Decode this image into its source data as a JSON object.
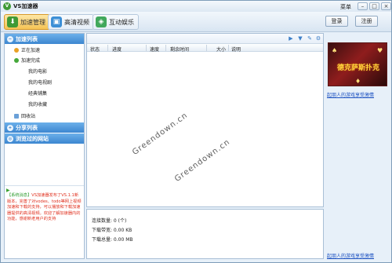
{
  "app": {
    "title": "VS加速器",
    "menu": "菜单"
  },
  "toolbar": {
    "tabs": [
      {
        "label": "加速管理"
      },
      {
        "label": "高清视频"
      },
      {
        "label": "互动娱乐"
      }
    ],
    "login": "登录",
    "register": "注册"
  },
  "sidebar": {
    "accel_list": "加速列表",
    "accelerating": "正在加速",
    "accel_done": "加速完成",
    "my_movies": "我的电影",
    "my_tv": "我的电视剧",
    "classics": "经典铺集",
    "favorites": "我的收藏",
    "recycle": "回收站",
    "share_list": "分享列表",
    "visited_sites": "浏览过的网站"
  },
  "message": {
    "tag": "【系统消息】",
    "body": "VS加速器发布了VS.1.1新版本，完善了对vodes、todo等网上视频加速和下载的支持，可以播放和下载加速器提供的高清视频。欢迎了解加速器内的功能，感谢新老用户的支持"
  },
  "list": {
    "columns": [
      "状态",
      "进度",
      "速度",
      "剩余时间",
      "大小",
      "说明"
    ],
    "watermark": "Greendown.cn"
  },
  "stats": {
    "connections": "连接数量: 0 (个)",
    "download_bandwidth": "下载带宽: 0.00 KB",
    "download_total": "下载总量: 0.00 MB"
  },
  "ad": {
    "banner_text": "德克萨斯扑克",
    "link_top": "起朋人的游戏享受激情",
    "link_bottom": "起朋人的游戏享受激情"
  },
  "colors": {
    "accent": "#3c86d0",
    "active_tab": "#f5c354",
    "message_text": "#e0301e",
    "link": "#1a4fc0"
  }
}
